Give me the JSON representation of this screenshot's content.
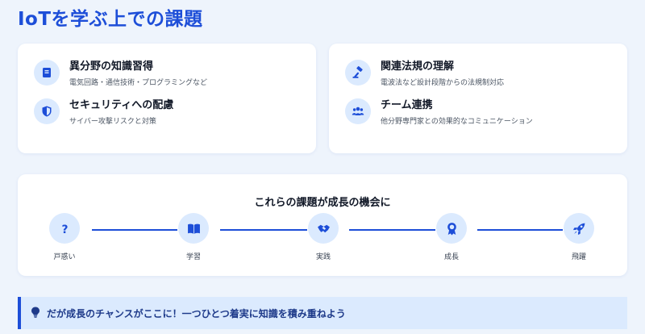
{
  "page": {
    "title": "IoTを学ぶ上での課題"
  },
  "challenges": {
    "left": [
      {
        "title": "異分野の知識習得",
        "desc": "電気回路・通信技術・プログラミングなど",
        "icon": "book-icon"
      },
      {
        "title": "セキュリティへの配慮",
        "desc": "サイバー攻撃リスクと対策",
        "icon": "shield-icon"
      }
    ],
    "right": [
      {
        "title": "関連法規の理解",
        "desc": "電波法など設計段階からの法規制対応",
        "icon": "gavel-icon"
      },
      {
        "title": "チーム連携",
        "desc": "他分野専門家との効果的なコミュニケーション",
        "icon": "team-icon"
      }
    ]
  },
  "growth": {
    "title": "これらの課題が成長の機会に",
    "stages": [
      {
        "label": "戸惑い",
        "icon": "question-icon"
      },
      {
        "label": "学習",
        "icon": "open-book-icon"
      },
      {
        "label": "実践",
        "icon": "handshake-icon"
      },
      {
        "label": "成長",
        "icon": "award-icon"
      },
      {
        "label": "飛躍",
        "icon": "rocket-icon"
      }
    ]
  },
  "banner": {
    "text": "だが成長のチャンスがここに！一つひとつ着実に知識を積み重ねよう",
    "icon": "lightbulb-icon"
  },
  "colors": {
    "accent": "#1d4ed8",
    "icon_bg": "#dbeafe",
    "page_bg": "#eef4fc"
  }
}
